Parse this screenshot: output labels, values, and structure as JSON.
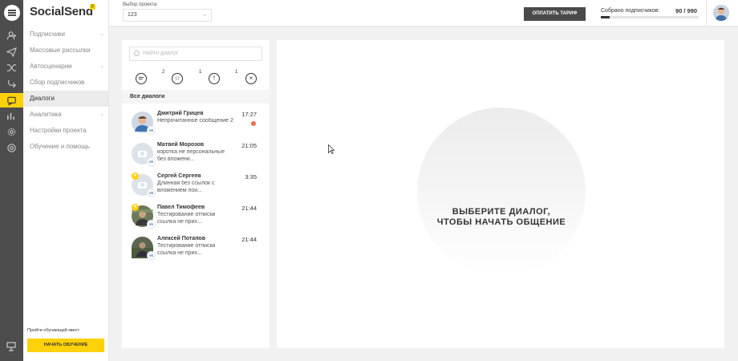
{
  "app": {
    "logo": "SocialSend",
    "logo_badge": "β"
  },
  "rail": {
    "icons": [
      "menu-icon",
      "users-icon",
      "send-icon",
      "shuffle-icon",
      "collect-icon",
      "chat-icon",
      "chart-icon",
      "gear-icon",
      "help-icon",
      "learn-icon"
    ]
  },
  "sidebar": {
    "items": [
      {
        "label": "Подписчики",
        "has_chevron": true
      },
      {
        "label": "Массовые рассылки",
        "has_chevron": false
      },
      {
        "label": "Автосценарии",
        "has_chevron": true
      },
      {
        "label": "Сбор подписчиков",
        "has_chevron": false
      },
      {
        "label": "Диалоги",
        "has_chevron": false,
        "active": true
      },
      {
        "label": "Аналитика",
        "has_chevron": true
      },
      {
        "label": "Настройки проекта",
        "has_chevron": false
      },
      {
        "label": "Обучение и помощь",
        "has_chevron": false
      }
    ],
    "quest_label": "Пройти обучающий квест",
    "start_button": "НАЧАТЬ ОБУЧЕНИЕ"
  },
  "header": {
    "project_label": "Выбор проекта:",
    "project_value": "123",
    "pay_button": "ОПЛАТИТЬ ТАРИФ",
    "subscribers_label": "Собрано подписчиков:",
    "subscribers_count": "90 / 990",
    "subscribers_progress": 0.091
  },
  "dialogs": {
    "search_placeholder": "Найти диалог",
    "filters": [
      {
        "icon": "chat-bubble-icon",
        "count": "2"
      },
      {
        "icon": "star-icon",
        "count": "1"
      },
      {
        "icon": "exclamation-icon",
        "count": "1"
      },
      {
        "icon": "close-circle-icon",
        "count": ""
      }
    ],
    "header": "Все диалоги",
    "items": [
      {
        "name": "Дмитрий Грицев",
        "message": "Непрочитанное сообщение 2",
        "time": "17:27",
        "unread": true,
        "starred": false,
        "photo": true
      },
      {
        "name": "Матвей Морозов",
        "message": "коротка не персональные без вложени...",
        "time": "21:05",
        "unread": false,
        "starred": false,
        "photo": false
      },
      {
        "name": "Сергей Сергеев",
        "message": "Длинная без ссылок с вложением пои...",
        "time": "3:35",
        "unread": false,
        "starred": true,
        "photo": false
      },
      {
        "name": "Павел Тимофеев",
        "message": "Тестирование отписки ссылка не прих...",
        "time": "21:44",
        "unread": false,
        "starred": true,
        "photo": true
      },
      {
        "name": "Алексей Потапов",
        "message": "Тестирование отписки ссылка не прих...",
        "time": "21:44",
        "unread": false,
        "starred": false,
        "photo": true
      }
    ],
    "network_badge": "vk"
  },
  "main": {
    "empty_line1": "ВЫБЕРИТЕ ДИАЛОГ,",
    "empty_line2": "ЧТОБЫ НАЧАТЬ ОБЩЕНИЕ"
  },
  "colors": {
    "accent": "#ffd10a",
    "rail": "#4d4d4d",
    "unread_dot": "#f06b4b",
    "vk": "#4a76a8"
  }
}
